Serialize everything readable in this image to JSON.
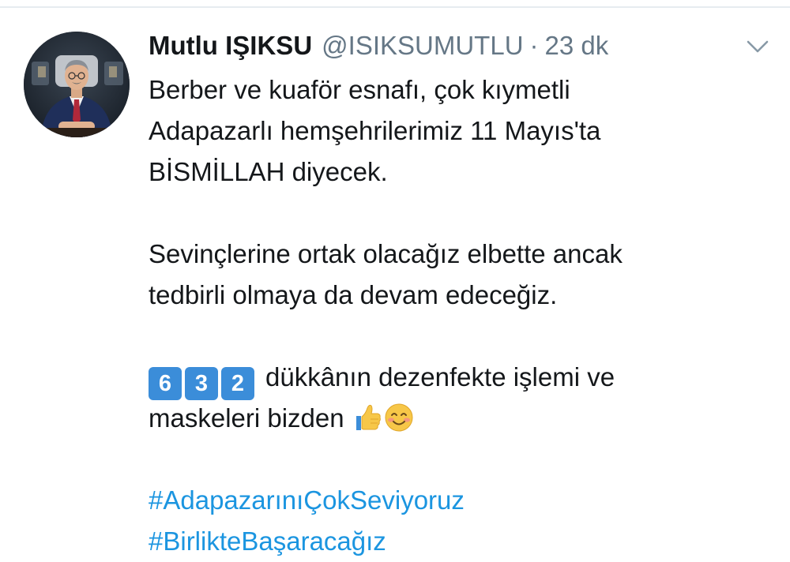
{
  "tweet": {
    "author": {
      "display_name": "Mutlu IŞIKSU",
      "handle": "@ISIKSUMUTLU"
    },
    "separator": "·",
    "timestamp": "23 dk",
    "lines": {
      "l1": "Berber ve kuaför esnafı, çok kıymetli",
      "l2": "Adapazarlı hemşehrilerimiz 11 Mayıs'ta",
      "l3": "BİSMİLLAH diyecek.",
      "l4": "Sevinçlerine ortak olacağız elbette ancak",
      "l5": "tedbirli olmaya da devam edeceğiz.",
      "l6_keycaps": [
        "6",
        "3",
        "2"
      ],
      "l6": "dükkânın dezenfekte işlemi ve",
      "l7": "maskeleri bizden"
    },
    "emojis": [
      "thumbs-up",
      "smiling-face-with-smiling-eyes"
    ],
    "hashtags": [
      "#AdapazarınıÇokSeviyoruz",
      "#BirlikteBaşaracağız"
    ],
    "colors": {
      "text": "#14171a",
      "secondary": "#657786",
      "link": "#1b95e0",
      "keycap": "#3b8dd9"
    },
    "icons": {
      "menu": "chevron-down-icon"
    }
  }
}
